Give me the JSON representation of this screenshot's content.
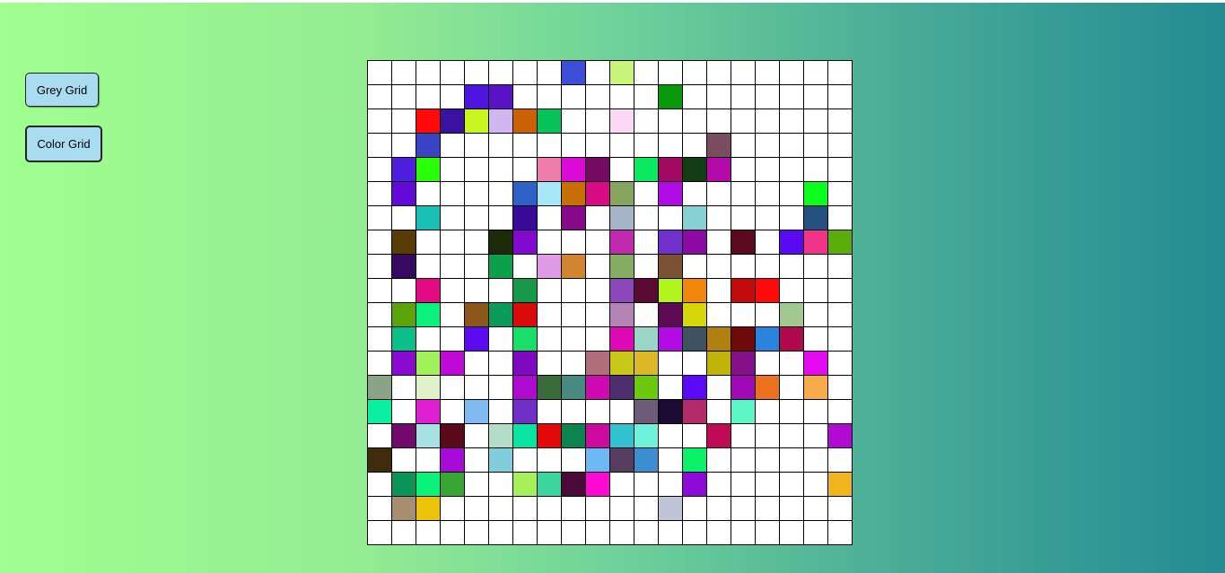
{
  "controls": {
    "grey_grid_label": "Grey Grid",
    "color_grid_label": "Color Grid"
  },
  "grid": {
    "rows": 20,
    "cols": 20,
    "default_color": "#ffffff",
    "colored_cells": [
      {
        "r": 0,
        "c": 8,
        "color": "#3d4fd6"
      },
      {
        "r": 0,
        "c": 10,
        "color": "#c8f57a"
      },
      {
        "r": 1,
        "c": 4,
        "color": "#4f14e0"
      },
      {
        "r": 1,
        "c": 5,
        "color": "#5a12c7"
      },
      {
        "r": 1,
        "c": 12,
        "color": "#089a0a"
      },
      {
        "r": 2,
        "c": 2,
        "color": "#ff0a0a"
      },
      {
        "r": 2,
        "c": 3,
        "color": "#3a12a0"
      },
      {
        "r": 2,
        "c": 4,
        "color": "#c8f51e"
      },
      {
        "r": 2,
        "c": 5,
        "color": "#d2b6f2"
      },
      {
        "r": 2,
        "c": 6,
        "color": "#cc6006"
      },
      {
        "r": 2,
        "c": 7,
        "color": "#08c25a"
      },
      {
        "r": 2,
        "c": 10,
        "color": "#fbd8f4"
      },
      {
        "r": 3,
        "c": 2,
        "color": "#3a44c4"
      },
      {
        "r": 3,
        "c": 14,
        "color": "#7a4c62"
      },
      {
        "r": 4,
        "c": 1,
        "color": "#4d20e0"
      },
      {
        "r": 4,
        "c": 2,
        "color": "#2aff0a"
      },
      {
        "r": 4,
        "c": 7,
        "color": "#f07cac"
      },
      {
        "r": 4,
        "c": 8,
        "color": "#dc0ad8"
      },
      {
        "r": 4,
        "c": 9,
        "color": "#740a64"
      },
      {
        "r": 4,
        "c": 11,
        "color": "#0aea60"
      },
      {
        "r": 4,
        "c": 12,
        "color": "#a20a62"
      },
      {
        "r": 4,
        "c": 13,
        "color": "#123c14"
      },
      {
        "r": 4,
        "c": 14,
        "color": "#b40aaa"
      },
      {
        "r": 5,
        "c": 1,
        "color": "#640ad8"
      },
      {
        "r": 5,
        "c": 6,
        "color": "#2e62c6"
      },
      {
        "r": 5,
        "c": 7,
        "color": "#a6e8f8"
      },
      {
        "r": 5,
        "c": 8,
        "color": "#c86e06"
      },
      {
        "r": 5,
        "c": 9,
        "color": "#d80a86"
      },
      {
        "r": 5,
        "c": 10,
        "color": "#86a45e"
      },
      {
        "r": 5,
        "c": 12,
        "color": "#b00ae6"
      },
      {
        "r": 5,
        "c": 18,
        "color": "#0aff1e"
      },
      {
        "r": 6,
        "c": 2,
        "color": "#18c0b8"
      },
      {
        "r": 6,
        "c": 6,
        "color": "#3a0a98"
      },
      {
        "r": 6,
        "c": 8,
        "color": "#860a8a"
      },
      {
        "r": 6,
        "c": 10,
        "color": "#a6b6c8"
      },
      {
        "r": 6,
        "c": 13,
        "color": "#86d2d2"
      },
      {
        "r": 6,
        "c": 18,
        "color": "#245080"
      },
      {
        "r": 7,
        "c": 1,
        "color": "#5a3c06"
      },
      {
        "r": 7,
        "c": 5,
        "color": "#1c2c0a"
      },
      {
        "r": 7,
        "c": 6,
        "color": "#800ad0"
      },
      {
        "r": 7,
        "c": 10,
        "color": "#c02aae"
      },
      {
        "r": 7,
        "c": 12,
        "color": "#7030cc"
      },
      {
        "r": 7,
        "c": 13,
        "color": "#8c0aa2"
      },
      {
        "r": 7,
        "c": 15,
        "color": "#5c0a1e"
      },
      {
        "r": 7,
        "c": 17,
        "color": "#5a0af0"
      },
      {
        "r": 7,
        "c": 18,
        "color": "#f0348a"
      },
      {
        "r": 7,
        "c": 19,
        "color": "#5aae0a"
      },
      {
        "r": 8,
        "c": 1,
        "color": "#360a60"
      },
      {
        "r": 8,
        "c": 5,
        "color": "#0ca04a"
      },
      {
        "r": 8,
        "c": 7,
        "color": "#e09ae6"
      },
      {
        "r": 8,
        "c": 8,
        "color": "#d08630"
      },
      {
        "r": 8,
        "c": 10,
        "color": "#86ae62"
      },
      {
        "r": 8,
        "c": 12,
        "color": "#7c5236"
      },
      {
        "r": 9,
        "c": 2,
        "color": "#e40a84"
      },
      {
        "r": 9,
        "c": 6,
        "color": "#169a4a"
      },
      {
        "r": 9,
        "c": 10,
        "color": "#8a48b8"
      },
      {
        "r": 9,
        "c": 11,
        "color": "#5c0a34"
      },
      {
        "r": 9,
        "c": 12,
        "color": "#b2f51e"
      },
      {
        "r": 9,
        "c": 13,
        "color": "#f2860a"
      },
      {
        "r": 9,
        "c": 15,
        "color": "#c40a0a"
      },
      {
        "r": 9,
        "c": 16,
        "color": "#ff0a0a"
      },
      {
        "r": 10,
        "c": 1,
        "color": "#5aa40a"
      },
      {
        "r": 10,
        "c": 2,
        "color": "#0af27e"
      },
      {
        "r": 10,
        "c": 4,
        "color": "#8a561a"
      },
      {
        "r": 10,
        "c": 5,
        "color": "#0a9a5a"
      },
      {
        "r": 10,
        "c": 6,
        "color": "#d80a0a"
      },
      {
        "r": 10,
        "c": 10,
        "color": "#b484b6"
      },
      {
        "r": 10,
        "c": 12,
        "color": "#5c0a54"
      },
      {
        "r": 10,
        "c": 13,
        "color": "#d6d60a"
      },
      {
        "r": 10,
        "c": 17,
        "color": "#a2c892"
      },
      {
        "r": 11,
        "c": 1,
        "color": "#0ac08a"
      },
      {
        "r": 11,
        "c": 4,
        "color": "#5c0af0"
      },
      {
        "r": 11,
        "c": 6,
        "color": "#1ade6a"
      },
      {
        "r": 11,
        "c": 10,
        "color": "#de0ab6"
      },
      {
        "r": 11,
        "c": 11,
        "color": "#9ad6c8"
      },
      {
        "r": 11,
        "c": 12,
        "color": "#b40ae6"
      },
      {
        "r": 11,
        "c": 13,
        "color": "#3e5262"
      },
      {
        "r": 11,
        "c": 14,
        "color": "#b08010"
      },
      {
        "r": 11,
        "c": 15,
        "color": "#6e0a0a"
      },
      {
        "r": 11,
        "c": 16,
        "color": "#2a84de"
      },
      {
        "r": 11,
        "c": 17,
        "color": "#b00a4e"
      },
      {
        "r": 12,
        "c": 1,
        "color": "#8a0ad2"
      },
      {
        "r": 12,
        "c": 2,
        "color": "#a0f05a"
      },
      {
        "r": 12,
        "c": 3,
        "color": "#c00ad8"
      },
      {
        "r": 12,
        "c": 6,
        "color": "#7e0ac0"
      },
      {
        "r": 12,
        "c": 9,
        "color": "#b06e7a"
      },
      {
        "r": 12,
        "c": 10,
        "color": "#c8c818"
      },
      {
        "r": 12,
        "c": 11,
        "color": "#deb826"
      },
      {
        "r": 12,
        "c": 14,
        "color": "#c0b40a"
      },
      {
        "r": 12,
        "c": 15,
        "color": "#86108a"
      },
      {
        "r": 12,
        "c": 18,
        "color": "#e40af2"
      },
      {
        "r": 13,
        "c": 0,
        "color": "#8aa488"
      },
      {
        "r": 13,
        "c": 2,
        "color": "#e0f2c8"
      },
      {
        "r": 13,
        "c": 6,
        "color": "#ae0ad0"
      },
      {
        "r": 13,
        "c": 7,
        "color": "#3a6c3a"
      },
      {
        "r": 13,
        "c": 8,
        "color": "#468a80"
      },
      {
        "r": 13,
        "c": 9,
        "color": "#d00ab2"
      },
      {
        "r": 13,
        "c": 10,
        "color": "#4e2e6e"
      },
      {
        "r": 13,
        "c": 11,
        "color": "#6cc80a"
      },
      {
        "r": 13,
        "c": 13,
        "color": "#5a0af6"
      },
      {
        "r": 13,
        "c": 15,
        "color": "#a00ab6"
      },
      {
        "r": 13,
        "c": 16,
        "color": "#ec7220"
      },
      {
        "r": 13,
        "c": 18,
        "color": "#f6ac4a"
      },
      {
        "r": 14,
        "c": 0,
        "color": "#0af0a2"
      },
      {
        "r": 14,
        "c": 2,
        "color": "#de20d2"
      },
      {
        "r": 14,
        "c": 4,
        "color": "#80baf0"
      },
      {
        "r": 14,
        "c": 6,
        "color": "#7030c6"
      },
      {
        "r": 14,
        "c": 11,
        "color": "#6e5c78"
      },
      {
        "r": 14,
        "c": 12,
        "color": "#1c0a34"
      },
      {
        "r": 14,
        "c": 13,
        "color": "#b22c6a"
      },
      {
        "r": 14,
        "c": 15,
        "color": "#5af6c6"
      },
      {
        "r": 15,
        "c": 1,
        "color": "#700a6c"
      },
      {
        "r": 15,
        "c": 2,
        "color": "#a8e0e4"
      },
      {
        "r": 15,
        "c": 3,
        "color": "#5a0a1a"
      },
      {
        "r": 15,
        "c": 5,
        "color": "#b2dec8"
      },
      {
        "r": 15,
        "c": 6,
        "color": "#0ae4a2"
      },
      {
        "r": 15,
        "c": 7,
        "color": "#e40a0a"
      },
      {
        "r": 15,
        "c": 8,
        "color": "#0a8450"
      },
      {
        "r": 15,
        "c": 9,
        "color": "#cc0aa0"
      },
      {
        "r": 15,
        "c": 10,
        "color": "#30c2d0"
      },
      {
        "r": 15,
        "c": 11,
        "color": "#6ef2dc"
      },
      {
        "r": 15,
        "c": 14,
        "color": "#c00a56"
      },
      {
        "r": 15,
        "c": 19,
        "color": "#b20ad0"
      },
      {
        "r": 16,
        "c": 0,
        "color": "#402c0a"
      },
      {
        "r": 16,
        "c": 3,
        "color": "#a80ad8"
      },
      {
        "r": 16,
        "c": 5,
        "color": "#80cedc"
      },
      {
        "r": 16,
        "c": 9,
        "color": "#6eb8f6"
      },
      {
        "r": 16,
        "c": 10,
        "color": "#563e60"
      },
      {
        "r": 16,
        "c": 11,
        "color": "#3c8ed0"
      },
      {
        "r": 16,
        "c": 13,
        "color": "#0af26a"
      },
      {
        "r": 17,
        "c": 1,
        "color": "#0a9458"
      },
      {
        "r": 17,
        "c": 2,
        "color": "#0af27a"
      },
      {
        "r": 17,
        "c": 3,
        "color": "#38a634"
      },
      {
        "r": 17,
        "c": 6,
        "color": "#a8f05a"
      },
      {
        "r": 17,
        "c": 7,
        "color": "#3ad49e"
      },
      {
        "r": 17,
        "c": 8,
        "color": "#4a0a3a"
      },
      {
        "r": 17,
        "c": 9,
        "color": "#ff0ad2"
      },
      {
        "r": 17,
        "c": 13,
        "color": "#8e0ad8"
      },
      {
        "r": 17,
        "c": 19,
        "color": "#f0b41e"
      },
      {
        "r": 18,
        "c": 1,
        "color": "#a88e70"
      },
      {
        "r": 18,
        "c": 2,
        "color": "#ecc20a"
      },
      {
        "r": 18,
        "c": 12,
        "color": "#c0c4d6"
      }
    ]
  }
}
